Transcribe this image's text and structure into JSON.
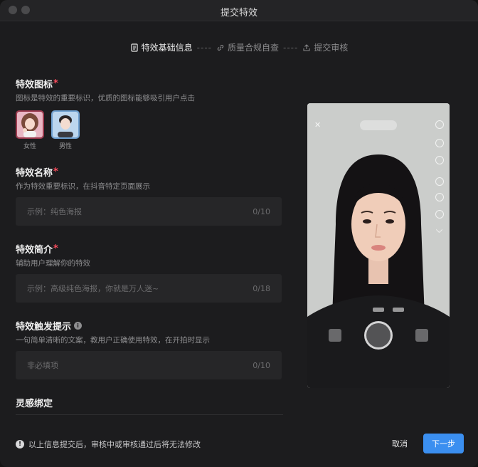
{
  "window": {
    "title": "提交特效"
  },
  "steps": [
    {
      "label": "特效基础信息",
      "icon": "document-icon",
      "active": true
    },
    {
      "label": "质量合规自查",
      "icon": "link-icon",
      "active": false
    },
    {
      "label": "提交审核",
      "icon": "upload-icon",
      "active": false
    }
  ],
  "step_separator": "----",
  "form": {
    "icon_section": {
      "label": "特效图标",
      "required_mark": "*",
      "hint": "图标是特效的重要标识，优质的图标能够吸引用户点击",
      "options": [
        {
          "label": "女性",
          "icon": "female-avatar-icon"
        },
        {
          "label": "男性",
          "icon": "male-avatar-icon"
        }
      ]
    },
    "name_section": {
      "label": "特效名称",
      "required_mark": "*",
      "hint": "作为特效重要标识，在抖音特定页面展示",
      "placeholder": "示例：纯色海报",
      "count": "0/10"
    },
    "intro_section": {
      "label": "特效简介",
      "required_mark": "*",
      "hint": "辅助用户理解你的特效",
      "placeholder": "示例：高级纯色海报，你就是万人迷~",
      "count": "0/18"
    },
    "trigger_section": {
      "label": "特效触发提示",
      "info_glyph": "i",
      "hint": "一句简单清晰的文案，教用户正确使用特效，在开拍时显示",
      "placeholder": "非必填项",
      "count": "0/10"
    },
    "inspiration_section": {
      "label": "灵感绑定"
    }
  },
  "footer": {
    "warning_glyph": "!",
    "note": "以上信息提交后，审核中或审核通过后将无法修改",
    "cancel_label": "取消",
    "next_label": "下一步"
  },
  "preview": {
    "close_glyph": "✕",
    "side_icons": [
      "flip-camera-icon",
      "beauty-icon",
      "timer-icon",
      "filter-icon",
      "speed-icon",
      "settings-icon",
      "chevron-down-icon"
    ]
  },
  "colors": {
    "accent": "#3b8ff0",
    "required": "#ff4d5e",
    "background": "#1c1c1e"
  }
}
